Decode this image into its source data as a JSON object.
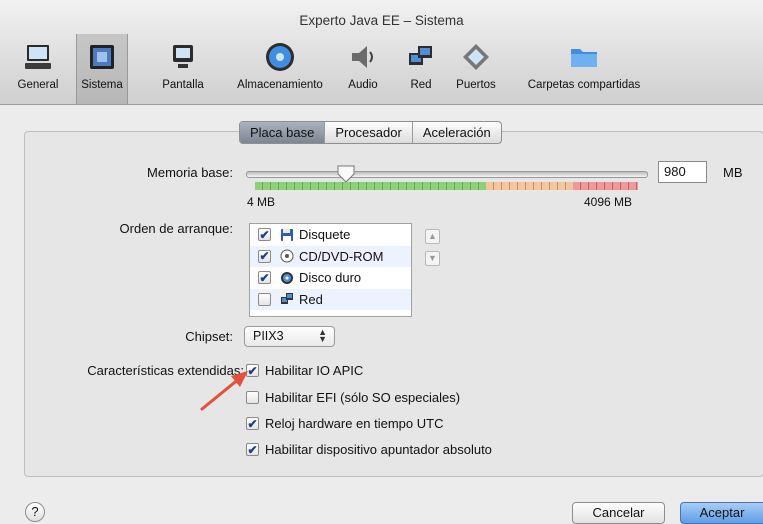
{
  "window": {
    "title": "Experto Java EE – Sistema"
  },
  "toolbar": [
    {
      "label": "General",
      "icon": "monitor-icon"
    },
    {
      "label": "Sistema",
      "icon": "chip-icon"
    },
    {
      "label": "Pantalla",
      "icon": "display-icon"
    },
    {
      "label": "Almacenamiento",
      "icon": "disk-icon"
    },
    {
      "label": "Audio",
      "icon": "speaker-icon"
    },
    {
      "label": "Red",
      "icon": "network-icon"
    },
    {
      "label": "Puertos",
      "icon": "port-icon"
    },
    {
      "label": "Carpetas compartidas",
      "icon": "folder-icon"
    }
  ],
  "tabs": [
    {
      "label": "Placa base",
      "selected": true
    },
    {
      "label": "Procesador",
      "selected": false
    },
    {
      "label": "Aceleración",
      "selected": false
    }
  ],
  "memory": {
    "label": "Memoria base:",
    "value": "980",
    "unit": "MB",
    "min_label": "4 MB",
    "max_label": "4096 MB",
    "level": 0.238
  },
  "boot_order": {
    "label": "Orden de arranque:",
    "items": [
      {
        "label": "Disquete",
        "checked": true,
        "icon": "floppy-icon"
      },
      {
        "label": "CD/DVD-ROM",
        "checked": true,
        "icon": "cd-icon"
      },
      {
        "label": "Disco duro",
        "checked": true,
        "icon": "harddisk-icon"
      },
      {
        "label": "Red",
        "checked": false,
        "icon": "network-icon"
      }
    ]
  },
  "chipset": {
    "label": "Chipset:",
    "value": "PIIX3"
  },
  "extended": {
    "label": "Características extendidas:",
    "options": [
      {
        "label": "Habilitar IO APIC",
        "checked": true
      },
      {
        "label": "Habilitar EFI (sólo SO especiales)",
        "checked": false
      },
      {
        "label": "Reloj hardware en tiempo UTC",
        "checked": true
      },
      {
        "label": "Habilitar dispositivo apuntador absoluto",
        "checked": true
      }
    ]
  },
  "buttons": {
    "help": "?",
    "cancel": "Cancelar",
    "accept": "Aceptar"
  },
  "colors": {
    "accent": "#5d9de9",
    "arrow": "#e4503a"
  }
}
